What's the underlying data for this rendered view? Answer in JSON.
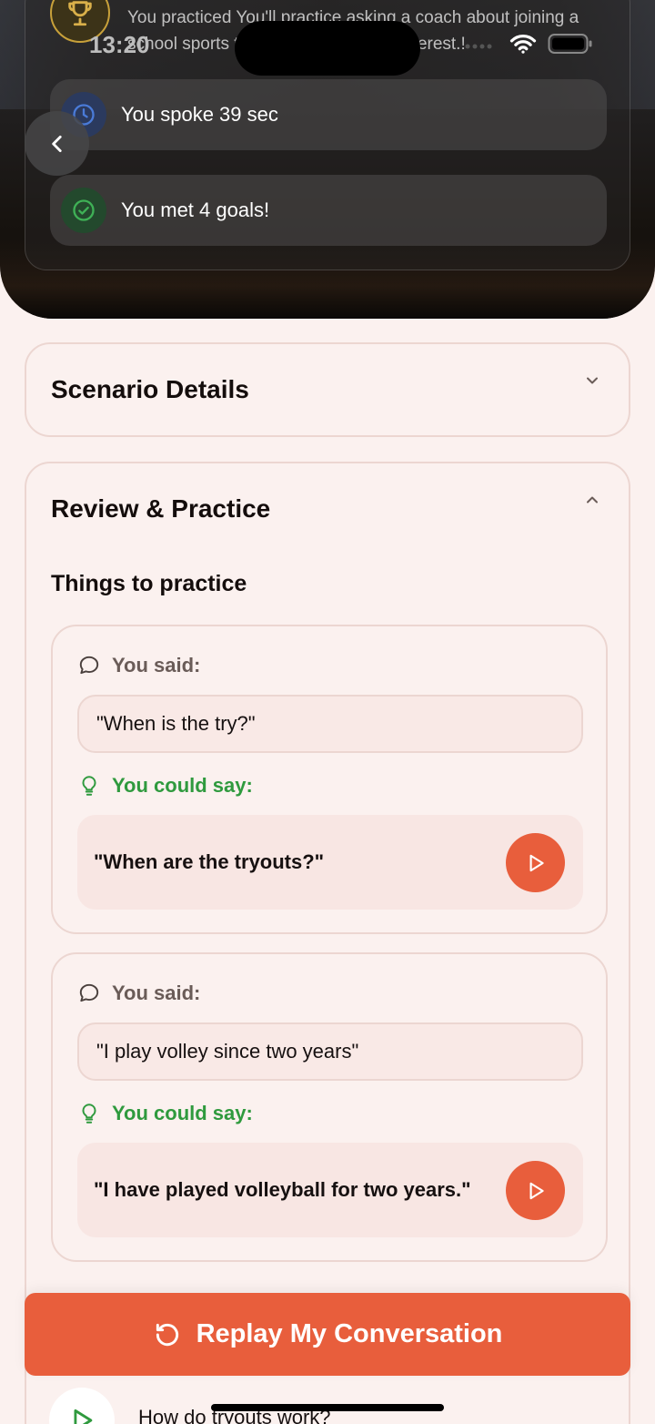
{
  "status_bar": {
    "time": "13:20"
  },
  "summary": {
    "practiced_text": "You practiced You'll practice asking a coach about joining a school sports team and expressing interest.!",
    "spoke_text": "You spoke 39 sec",
    "goals_text": "You met 4 goals!"
  },
  "scenario_details": {
    "title": "Scenario Details"
  },
  "review": {
    "title": "Review & Practice",
    "subtitle": "Things to practice",
    "items": [
      {
        "said_label": "You said:",
        "said": "\"When is the try?\"",
        "could_label": "You could say:",
        "could": "\"When are the tryouts?\""
      },
      {
        "said_label": "You said:",
        "said": "\"I play volley since two years\"",
        "could_label": "You could say:",
        "could": "\"I have played volleyball for two years.\""
      }
    ]
  },
  "replay_button": {
    "label": "Replay My Conversation"
  },
  "next_question": {
    "text": "How do tryouts work?"
  },
  "colors": {
    "accent": "#e85e3c",
    "success": "#2f9a3e",
    "trophy": "#c8a13a",
    "clock": "#4a7bd8"
  },
  "icons": [
    "trophy-icon",
    "clock-icon",
    "check-circle-icon",
    "back-arrow-icon",
    "chevron-down-icon",
    "chevron-up-icon",
    "speech-bubble-icon",
    "lightbulb-icon",
    "play-icon",
    "replay-icon"
  ]
}
